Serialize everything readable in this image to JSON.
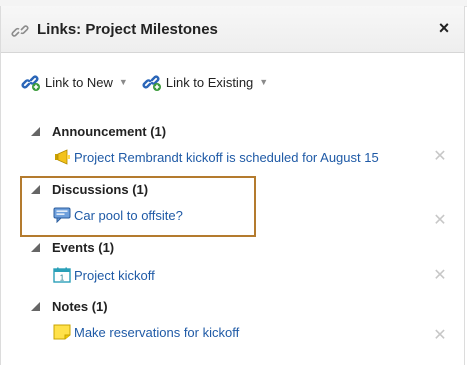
{
  "panel": {
    "title": "Links: Project Milestones",
    "close_label": "×"
  },
  "toolbar": {
    "link_new": {
      "label": "Link to New",
      "icon": "link-plus-icon",
      "caret": "▼"
    },
    "link_existing": {
      "label": "Link to Existing",
      "icon": "link-plus-icon",
      "caret": "▼"
    }
  },
  "sections": {
    "announcement": {
      "title": "Announcement (1)",
      "item": {
        "label": "Project Rembrandt kickoff is scheduled for August 15",
        "icon": "megaphone-icon"
      }
    },
    "discussions": {
      "title": "Discussions (1)",
      "item": {
        "label": "Car pool to offsite?",
        "icon": "speech-bubble-icon"
      }
    },
    "events": {
      "title": "Events (1)",
      "item": {
        "label": "Project kickoff",
        "icon": "calendar-icon",
        "day": "1"
      }
    },
    "notes": {
      "title": "Notes (1)",
      "item": {
        "label": "Make reservations for kickoff",
        "icon": "note-icon"
      }
    }
  },
  "colors": {
    "link_blue": "#1f5aa6",
    "highlight_border": "#b47b2e",
    "remove_gray": "#c7c7c7"
  }
}
